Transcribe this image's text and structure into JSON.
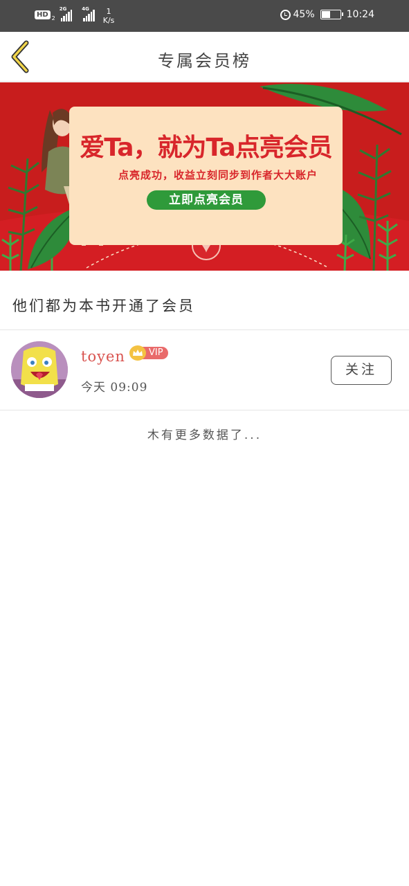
{
  "status_bar": {
    "hd_label": "HD",
    "hd_sub": "2",
    "signal1_label": "2G",
    "signal2_label": "4G",
    "speed_value": "1",
    "speed_unit": "K/s",
    "battery_percent": "45%",
    "battery_level": 0.45,
    "time": "10:24"
  },
  "nav": {
    "title": "专属会员榜",
    "back_icon": "chevron-left-icon"
  },
  "banner": {
    "headline": "爱Ta，就为Ta点亮会员",
    "subtitle": "点亮成功，收益立刻同步到作者大大账户",
    "cta_label": "立即点亮会员",
    "colors": {
      "background": "#c81d1d",
      "card": "#fde2c0",
      "accent": "#d8262b",
      "cta": "#2f9a3a"
    }
  },
  "section": {
    "title": "他们都为本书开通了会员"
  },
  "members": [
    {
      "username": "toyen",
      "vip_label": "VIP",
      "time": "今天 09:09",
      "follow_label": "关注"
    }
  ],
  "list_footer": "木有更多数据了..."
}
